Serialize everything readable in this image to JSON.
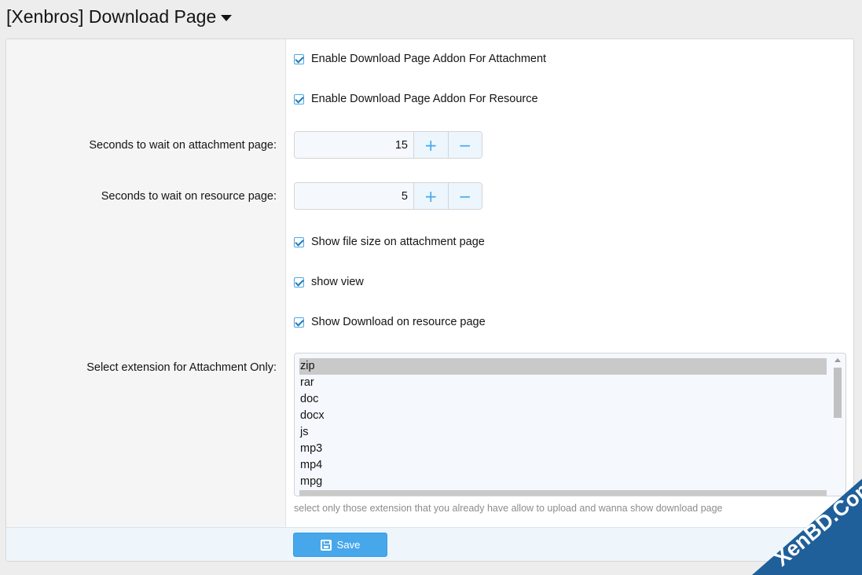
{
  "page": {
    "title": "[Xenbros] Download Page"
  },
  "options": {
    "enable_attachment": "Enable Download Page Addon For Attachment",
    "enable_resource": "Enable Download Page Addon For Resource",
    "attachment_wait": {
      "label": "Seconds to wait on attachment page:",
      "value": "15"
    },
    "resource_wait": {
      "label": "Seconds to wait on resource page:",
      "value": "5"
    },
    "show_file_size": "Show file size on attachment page",
    "show_view": "show view",
    "show_download": "Show Download on resource page",
    "extensions": {
      "label": "Select extension for Attachment Only:",
      "items": [
        "zip",
        "rar",
        "doc",
        "docx",
        "js",
        "mp3",
        "mp4",
        "mpg"
      ],
      "selected": "zip",
      "hint": "select only those extension that you already have allow to upload and wanna show download page"
    }
  },
  "stepper": {
    "plus": "+",
    "minus": "−"
  },
  "footer": {
    "save_label": "Save"
  },
  "watermark": {
    "text": "XenBD.Com"
  },
  "colors": {
    "accent": "#47a7eb",
    "background": "#ededed",
    "watermark": "#1f5f9a"
  }
}
